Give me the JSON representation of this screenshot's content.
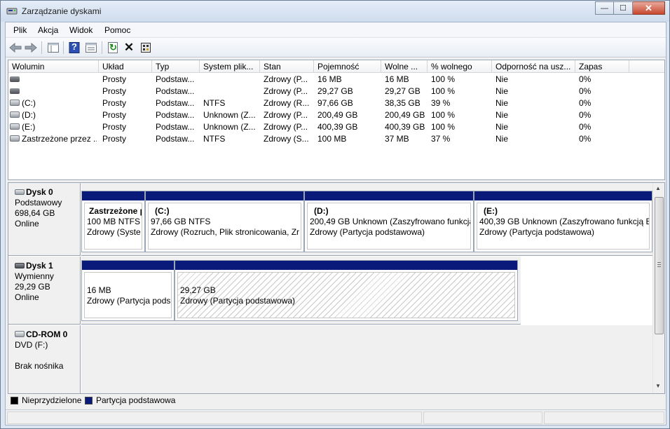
{
  "window": {
    "title": "Zarządzanie dyskami",
    "minimize_glyph": "—",
    "maximize_glyph": "☐",
    "close_glyph": "✕"
  },
  "menu": [
    "Plik",
    "Akcja",
    "Widok",
    "Pomoc"
  ],
  "toolbar": {
    "icons": [
      "back-arrow-icon",
      "forward-arrow-icon",
      "console-tree-icon",
      "help-icon",
      "properties-icon",
      "refresh-icon",
      "delete-icon",
      "settings-icon"
    ],
    "help_glyph": "?",
    "refresh_glyph": "↻",
    "delete_glyph": "✕"
  },
  "volume_list": {
    "columns": [
      "Wolumin",
      "Układ",
      "Typ",
      "System plik...",
      "Stan",
      "Pojemność",
      "Wolne ...",
      "% wolnego",
      "Odporność na usz...",
      "Zapas"
    ],
    "rows": [
      [
        "",
        "Prosty",
        "Podstaw...",
        "",
        "Zdrowy (P...",
        "16 MB",
        "16 MB",
        "100 %",
        "Nie",
        "0%"
      ],
      [
        "",
        "Prosty",
        "Podstaw...",
        "",
        "Zdrowy (P...",
        "29,27 GB",
        "29,27 GB",
        "100 %",
        "Nie",
        "0%"
      ],
      [
        "(C:)",
        "Prosty",
        "Podstaw...",
        "NTFS",
        "Zdrowy (R...",
        "97,66 GB",
        "38,35 GB",
        "39 %",
        "Nie",
        "0%"
      ],
      [
        "(D:)",
        "Prosty",
        "Podstaw...",
        "Unknown (Z...",
        "Zdrowy (P...",
        "200,49 GB",
        "200,49 GB",
        "100 %",
        "Nie",
        "0%"
      ],
      [
        "(E:)",
        "Prosty",
        "Podstaw...",
        "Unknown (Z...",
        "Zdrowy (P...",
        "400,39 GB",
        "400,39 GB",
        "100 %",
        "Nie",
        "0%"
      ],
      [
        "Zastrzeżone przez ...",
        "Prosty",
        "Podstaw...",
        "NTFS",
        "Zdrowy (S...",
        "100 MB",
        "37 MB",
        "37 %",
        "Nie",
        "0%"
      ]
    ],
    "row_icons": [
      "dark",
      "dark",
      "light",
      "light",
      "light",
      "light"
    ]
  },
  "disks": [
    {
      "name": "Dysk 0",
      "type": "Podstawowy",
      "size": "698,64 GB",
      "status": "Online",
      "partitions": [
        {
          "name": "Zastrzeżone p",
          "line1": "100 MB NTFS",
          "line2": "Zdrowy (Syste"
        },
        {
          "name": "(C:)",
          "line1": "97,66 GB NTFS",
          "line2": "Zdrowy (Rozruch, Plik stronicowania, Zr"
        },
        {
          "name": "(D:)",
          "line1": "200,49 GB Unknown (Zaszyfrowano funkcja",
          "line2": "Zdrowy (Partycja podstawowa)"
        },
        {
          "name": "(E:)",
          "line1": "400,39 GB Unknown (Zaszyfrowano funkcją Bi",
          "line2": "Zdrowy (Partycja podstawowa)"
        }
      ]
    },
    {
      "name": "Dysk 1",
      "type": "Wymienny",
      "size": "29,29 GB",
      "status": "Online",
      "partitions": [
        {
          "name": "",
          "line1": "16 MB",
          "line2": "Zdrowy (Partycja pods"
        },
        {
          "name": "",
          "line1": "29,27 GB",
          "line2": "Zdrowy (Partycja podstawowa)"
        }
      ]
    },
    {
      "name": "CD-ROM 0",
      "type": "DVD (F:)",
      "size": "",
      "status": "Brak nośnika"
    }
  ],
  "legend": {
    "unallocated": "Nieprzydzielone",
    "primary": "Partycja podstawowa",
    "unallocated_color": "#000000",
    "primary_color": "#0a1a7a"
  },
  "scrollbar": {
    "up_glyph": "▲",
    "down_glyph": "▼"
  }
}
